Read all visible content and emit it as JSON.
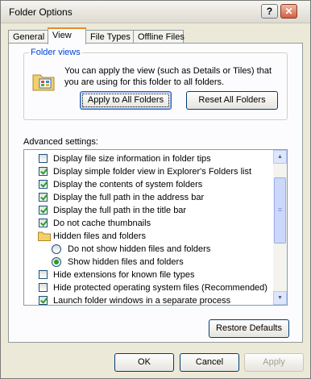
{
  "window": {
    "title": "Folder Options",
    "help_glyph": "?",
    "close_glyph": "✕"
  },
  "tabs": [
    {
      "label": "General"
    },
    {
      "label": "View"
    },
    {
      "label": "File Types"
    },
    {
      "label": "Offline Files"
    }
  ],
  "active_tab": "View",
  "folder_views": {
    "legend": "Folder views",
    "description": "You can apply the view (such as Details or Tiles) that you are using for this folder to all folders.",
    "apply_button": "Apply to All Folders",
    "reset_button": "Reset All Folders",
    "icon": "folder-views-icon"
  },
  "advanced": {
    "label": "Advanced settings:",
    "items": [
      {
        "type": "checkbox",
        "label": "Display file size information in folder tips",
        "checked": false
      },
      {
        "type": "checkbox",
        "label": "Display simple folder view in Explorer's Folders list",
        "checked": true
      },
      {
        "type": "checkbox",
        "label": "Display the contents of system folders",
        "checked": true
      },
      {
        "type": "checkbox",
        "label": "Display the full path in the address bar",
        "checked": true
      },
      {
        "type": "checkbox",
        "label": "Display the full path in the title bar",
        "checked": true
      },
      {
        "type": "checkbox",
        "label": "Do not cache thumbnails",
        "checked": true
      },
      {
        "type": "folder",
        "label": "Hidden files and folders"
      },
      {
        "type": "radio",
        "label": "Do not show hidden files and folders",
        "checked": false
      },
      {
        "type": "radio",
        "label": "Show hidden files and folders",
        "checked": true
      },
      {
        "type": "checkbox",
        "label": "Hide extensions for known file types",
        "checked": false
      },
      {
        "type": "checkbox",
        "label": "Hide protected operating system files (Recommended)",
        "checked": false
      },
      {
        "type": "checkbox",
        "label": "Launch folder windows in a separate process",
        "checked": true
      }
    ],
    "scroll_up_glyph": "▲",
    "scroll_down_glyph": "▼",
    "thumb_grip_glyph": "≡"
  },
  "restore_button": "Restore Defaults",
  "footer": {
    "ok": "OK",
    "cancel": "Cancel",
    "apply": "Apply"
  },
  "colors": {
    "accent": "#e68b2c",
    "legend": "#0046d5",
    "check": "#21a121"
  }
}
